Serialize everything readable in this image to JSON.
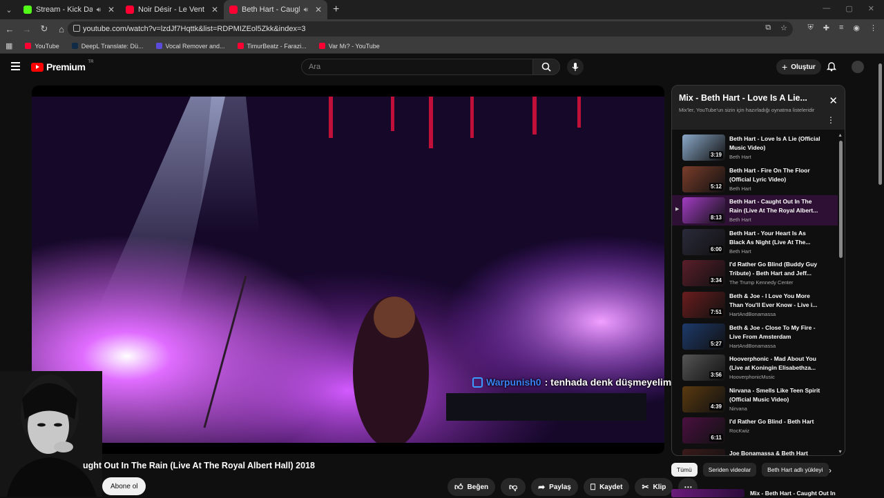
{
  "browser": {
    "tabs": [
      {
        "title": "Stream - Kick Dashboard",
        "fav_color": "#53fc18",
        "muted": true
      },
      {
        "title": "Noir Désir - Le Vent Nous Porte",
        "fav_color": "#ff0033",
        "muted": false
      },
      {
        "title": "Beth Hart - Caught Out In The",
        "fav_color": "#ff0033",
        "muted": true,
        "active": true
      }
    ],
    "url": "youtube.com/watch?v=lzdJf7Hqttk&list=RDPMIZEol5Zkk&index=3",
    "bookmarks": [
      {
        "label": "YouTube",
        "fav_color": "#ff0033"
      },
      {
        "label": "DeepL Translate: Dü...",
        "fav_color": "#0f2b46"
      },
      {
        "label": "Vocal Remover and...",
        "fav_color": "#5b4bdb"
      },
      {
        "label": "TimurBeatz - Farazi...",
        "fav_color": "#ff0033"
      },
      {
        "label": "Var Mı? - YouTube",
        "fav_color": "#ff0033"
      }
    ]
  },
  "header": {
    "logo_text": "Premium",
    "region": "TR",
    "search_placeholder": "Ara",
    "create_label": "Oluştur"
  },
  "player": {
    "chat_user": "Warpunish0",
    "chat_message": ": tenhada denk düşmeyelim"
  },
  "video": {
    "title_visible": "ught Out In The Rain (Live At The Royal Albert Hall) 2018",
    "subscribe_label": "Abone ol",
    "actions": {
      "like": "Beğen",
      "share": "Paylaş",
      "save": "Kaydet",
      "clip": "Klip"
    }
  },
  "playlist": {
    "title": "Mix - Beth Hart - Love Is A Lie...",
    "subtitle": "Mix'ler, YouTube'un sizin için hazırladığı oynatma listeleridir",
    "items": [
      {
        "title": "Beth Hart - Love Is A Lie (Official Music Video)",
        "channel": "Beth Hart",
        "duration": "3:19",
        "thumb": "#8aa8c8"
      },
      {
        "title": "Beth Hart - Fire On The Floor (Official Lyric Video)",
        "channel": "Beth Hart",
        "duration": "5:12",
        "thumb": "#7a3d2a"
      },
      {
        "title": "Beth Hart - Caught Out In The Rain (Live At The Royal Albert...",
        "channel": "Beth Hart",
        "duration": "8:13",
        "thumb": "#a23cc4",
        "active": true
      },
      {
        "title": "Beth Hart - Your Heart Is As Black As Night (Live At The...",
        "channel": "Beth Hart",
        "duration": "6:00",
        "thumb": "#2b2a3a"
      },
      {
        "title": "I'd Rather Go Blind (Buddy Guy Tribute) - Beth Hart and Jeff...",
        "channel": "The Trump Kennedy Center",
        "duration": "3:34",
        "thumb": "#5a1e2a"
      },
      {
        "title": "Beth & Joe - I Love You More Than You'll Ever Know - Live i...",
        "channel": "HartAndBonamassa",
        "duration": "7:51",
        "thumb": "#6b1d1d"
      },
      {
        "title": "Beth & Joe - Close To My Fire - Live From Amsterdam",
        "channel": "HartAndBonamassa",
        "duration": "5:27",
        "thumb": "#1d3a6b"
      },
      {
        "title": "Hooverphonic - Mad About You (Live at Koningin Elisabethza...",
        "channel": "HooverphonicMusic",
        "duration": "3:56",
        "thumb": "#555555"
      },
      {
        "title": "Nirvana - Smells Like Teen Spirit (Official Music Video)",
        "channel": "Nirvana",
        "duration": "4:39",
        "thumb": "#5a3a10"
      },
      {
        "title": "I'd Rather Go Blind - Beth Hart",
        "channel": "RocKwiz",
        "duration": "6:11",
        "thumb": "#4a1040"
      },
      {
        "title": "Joe Bonamassa & Beth Hart",
        "channel": "",
        "duration": "",
        "thumb": "#3a1a1a"
      }
    ]
  },
  "chips": [
    "Tümü",
    "Seriden videolar",
    "Beth Hart adlı yükleyi"
  ],
  "next_mix": {
    "title": "Mix - Beth Hart - Caught Out In"
  }
}
